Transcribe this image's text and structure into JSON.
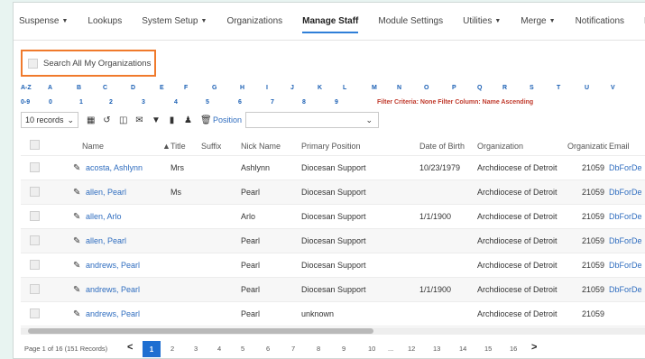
{
  "nav": [
    {
      "label": "Suspense",
      "caret": true
    },
    {
      "label": "Lookups",
      "caret": false
    },
    {
      "label": "System Setup",
      "caret": true
    },
    {
      "label": "Organizations",
      "caret": false
    },
    {
      "label": "Manage Staff",
      "caret": false,
      "active": true
    },
    {
      "label": "Module Settings",
      "caret": false
    },
    {
      "label": "Utilities",
      "caret": true
    },
    {
      "label": "Merge",
      "caret": true
    },
    {
      "label": "Notifications",
      "caret": false
    },
    {
      "label": "Reports",
      "caret": false
    }
  ],
  "search_all": {
    "label": "Search All My Organizations"
  },
  "alpha_row1": [
    "A-Z",
    "A",
    "B",
    "C",
    "D",
    "E",
    "F",
    "G",
    "H",
    "I",
    "J",
    "K",
    "L",
    "M",
    "N",
    "O",
    "P",
    "Q",
    "R",
    "S",
    "T",
    "U",
    "V"
  ],
  "alpha_row2": [
    "0-9",
    "0",
    "1",
    "2",
    "3",
    "4",
    "5",
    "6",
    "7",
    "8",
    "9"
  ],
  "filter_note": "Filter Criteria: None  Filter Column: Name Ascending",
  "toolbar": {
    "records": "10 records",
    "position_label": "Position",
    "icons": [
      "grid-icon",
      "refresh-icon",
      "columns-icon",
      "email-icon",
      "filter-icon",
      "export-icon",
      "add-user-icon",
      "delete-icon"
    ]
  },
  "table": {
    "headers": {
      "name": "Name",
      "title": "Title",
      "suffix": "Suffix",
      "nick": "Nick Name",
      "position": "Primary Position",
      "dob": "Date of Birth",
      "org": "Organization",
      "orgcode": "Organizatic",
      "email": "Email"
    },
    "rows": [
      {
        "name": "acosta, Ashlynn",
        "title": "Mrs",
        "nick": "Ashlynn",
        "position": "Diocesan Support",
        "dob": "10/23/1979",
        "org": "Archdiocese of Detroit",
        "orgcode": "21059",
        "email": "DbForDe"
      },
      {
        "name": "allen, Pearl",
        "title": "Ms",
        "nick": "Pearl",
        "position": "Diocesan Support",
        "dob": "",
        "org": "Archdiocese of Detroit",
        "orgcode": "21059",
        "email": "DbForDe"
      },
      {
        "name": "allen, Arlo",
        "title": "",
        "nick": "Arlo",
        "position": "Diocesan Support",
        "dob": "1/1/1900",
        "org": "Archdiocese of Detroit",
        "orgcode": "21059",
        "email": "DbForDe"
      },
      {
        "name": "allen, Pearl",
        "title": "",
        "nick": "Pearl",
        "position": "Diocesan Support",
        "dob": "",
        "org": "Archdiocese of Detroit",
        "orgcode": "21059",
        "email": "DbForDe"
      },
      {
        "name": "andrews, Pearl",
        "title": "",
        "nick": "Pearl",
        "position": "Diocesan Support",
        "dob": "",
        "org": "Archdiocese of Detroit",
        "orgcode": "21059",
        "email": "DbForDe"
      },
      {
        "name": "andrews, Pearl",
        "title": "",
        "nick": "Pearl",
        "position": "Diocesan Support",
        "dob": "1/1/1900",
        "org": "Archdiocese of Detroit",
        "orgcode": "21059",
        "email": "DbForDe"
      },
      {
        "name": "andrews, Pearl",
        "title": "",
        "nick": "Pearl",
        "position": "unknown",
        "dob": "",
        "org": "Archdiocese of Detroit",
        "orgcode": "21059",
        "email": ""
      }
    ]
  },
  "pager": {
    "info": "Page 1 of 16 (151 Records)",
    "prev": "<",
    "current": "1",
    "pages": [
      "2",
      "3",
      "4",
      "5",
      "6",
      "7",
      "8",
      "9",
      "10",
      "...",
      "12",
      "13",
      "14",
      "15",
      "16"
    ],
    "next": ">"
  }
}
